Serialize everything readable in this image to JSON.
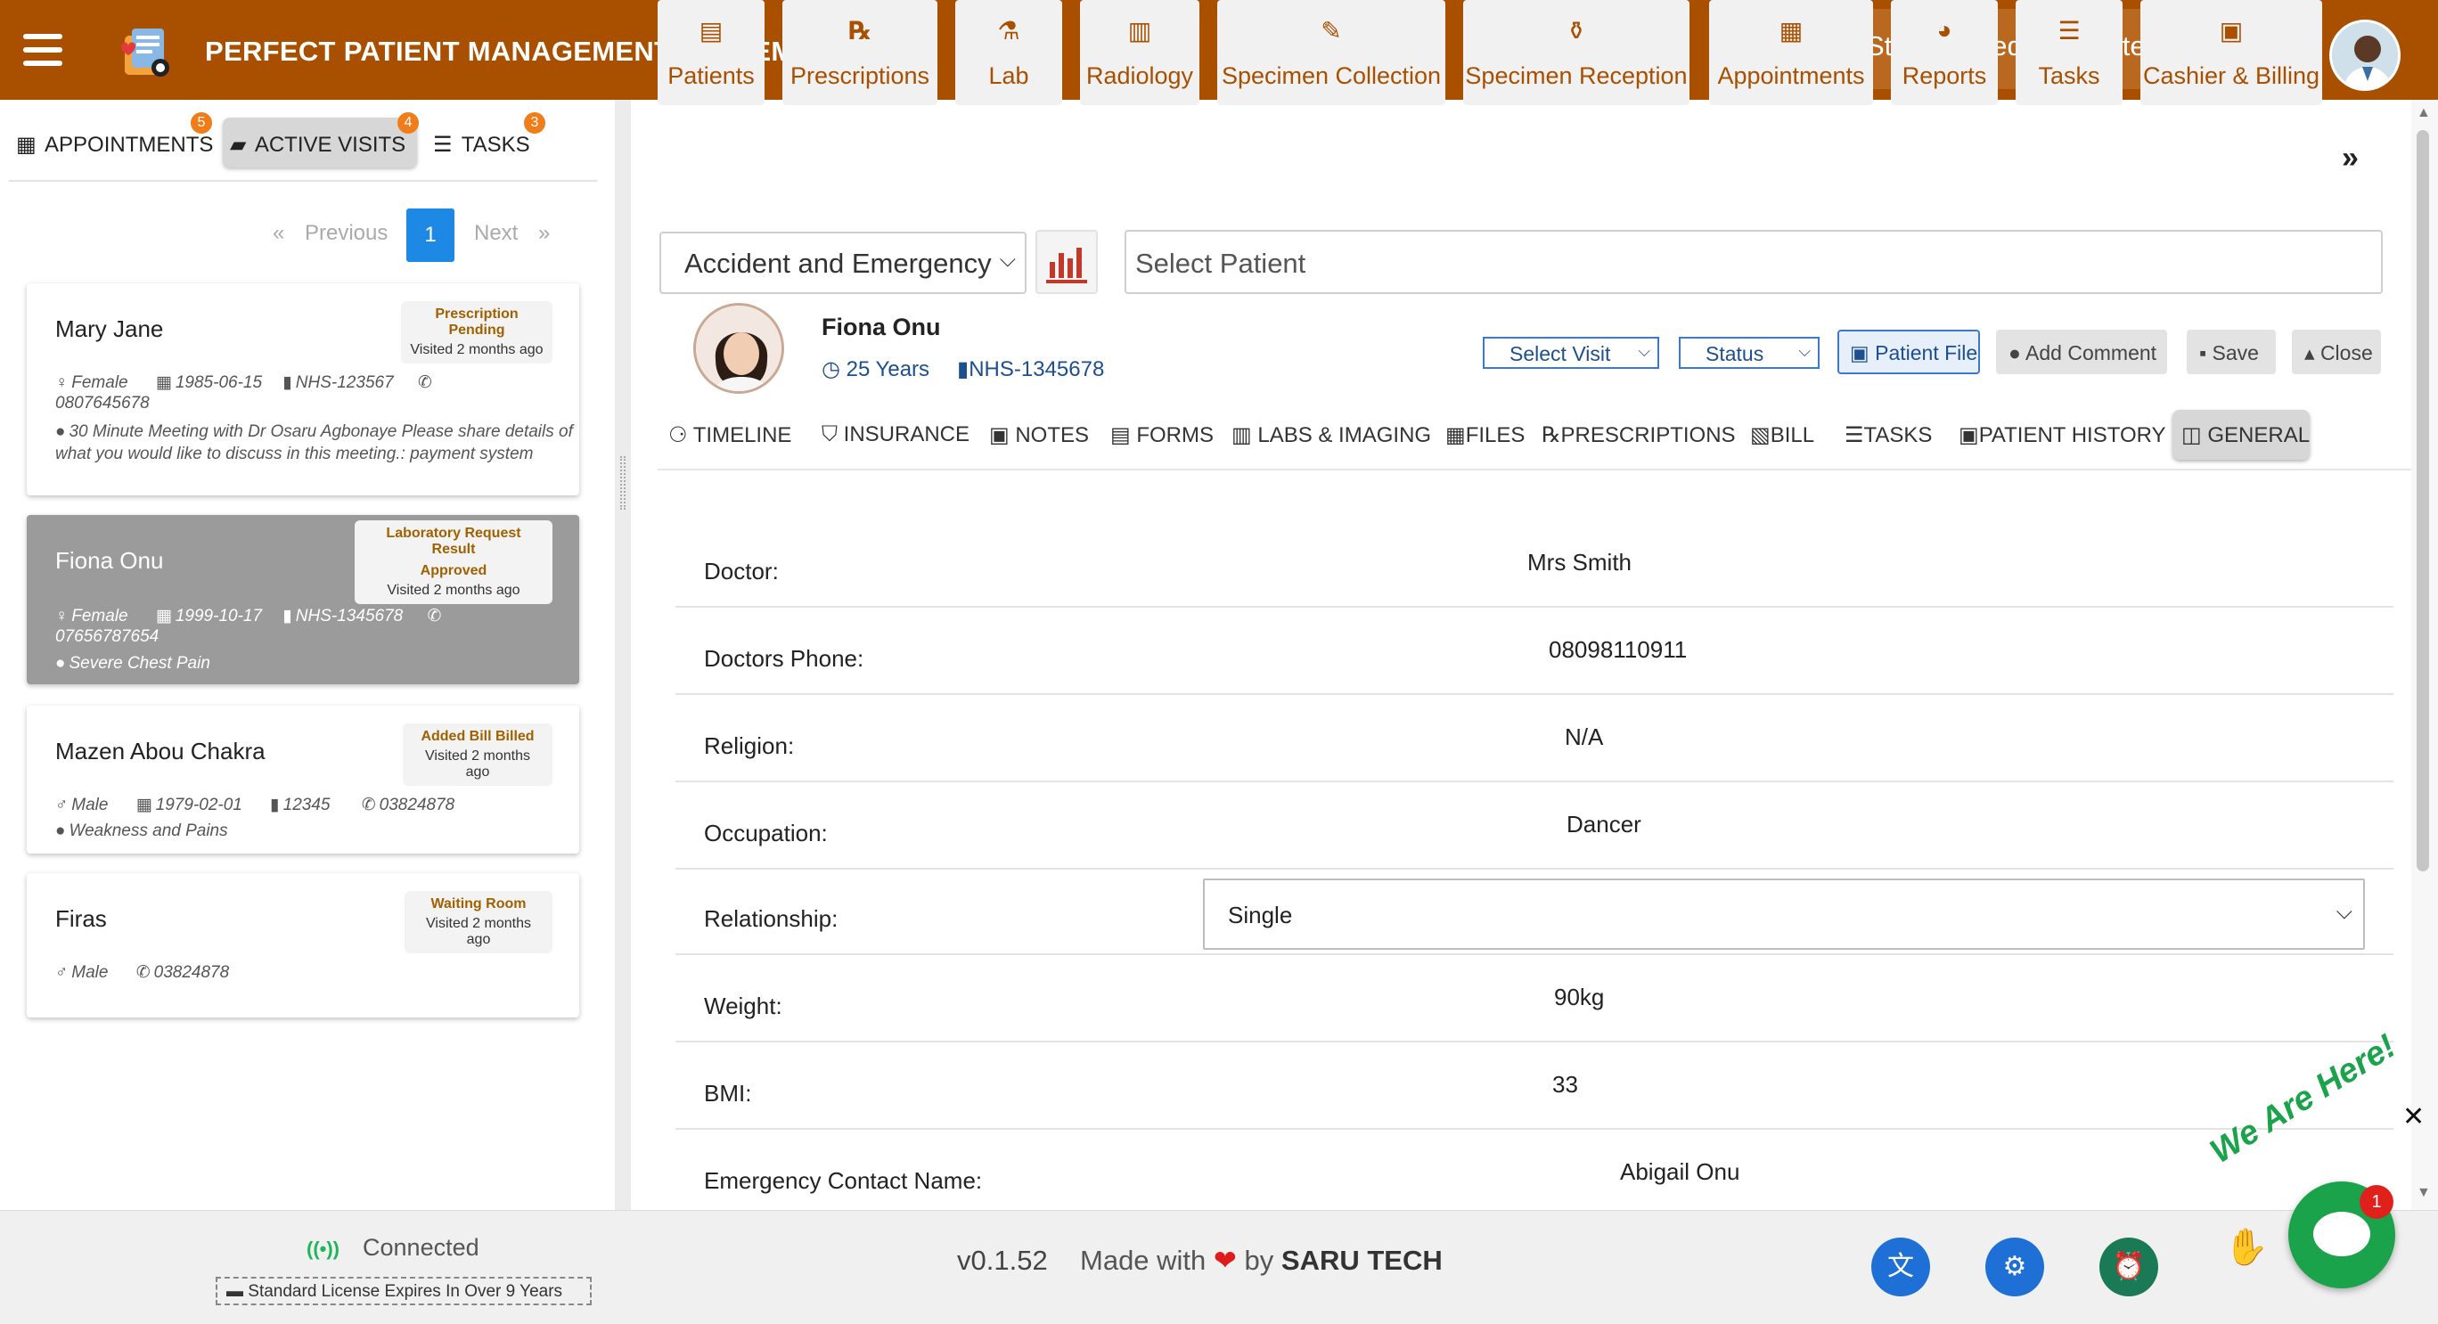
{
  "header": {
    "title": "PERFECT PATIENT MANAGEMENT SYSTEM",
    "facility": "St Mary Medical Center"
  },
  "left": {
    "tabs": [
      {
        "label": "APPOINTMENTS",
        "badge": "5"
      },
      {
        "label": "ACTIVE VISITS",
        "badge": "4"
      },
      {
        "label": "TASKS",
        "badge": "3"
      }
    ],
    "pager": {
      "previous": "Previous",
      "next": "Next",
      "current": "1",
      "prev_glyph": "«",
      "next_glyph": "»"
    },
    "visits": [
      {
        "name": "Mary Jane",
        "status": "Prescription Pending",
        "visited": "Visited 2 months ago",
        "gender": "Female",
        "dob": "1985-06-15",
        "nhs": "NHS-123567",
        "phone": "0807645678",
        "reason": "30 Minute Meeting with Dr Osaru Agbonaye Please share details of what you would like to discuss in this meeting.: payment system"
      },
      {
        "name": "Fiona Onu",
        "status": "Laboratory Request Result",
        "status2": "Approved",
        "visited": "Visited 2 months ago",
        "gender": "Female",
        "dob": "1999-10-17",
        "nhs": "NHS-1345678",
        "phone": "07656787654",
        "reason": "Severe Chest Pain"
      },
      {
        "name": "Mazen Abou Chakra",
        "status": "Added Bill Billed",
        "visited": "Visited 2 months ago",
        "gender": "Male",
        "dob": "1979-02-01",
        "nhs": "12345",
        "phone": "03824878",
        "reason": "Weakness and Pains"
      },
      {
        "name": "Firas",
        "status": "Waiting Room",
        "visited": "Visited 2 months ago",
        "gender": "Male",
        "phone": "03824878"
      }
    ]
  },
  "modules": [
    {
      "label": "Patients",
      "icon": "id-card-icon",
      "glyph": "▤"
    },
    {
      "label": "Prescriptions",
      "icon": "prescription-icon",
      "glyph": "℞"
    },
    {
      "label": "Lab",
      "icon": "flask-icon",
      "glyph": "⚗"
    },
    {
      "label": "Radiology",
      "icon": "radiology-icon",
      "glyph": "▥"
    },
    {
      "label": "Specimen Collection",
      "icon": "syringe-icon",
      "glyph": "✎"
    },
    {
      "label": "Specimen Reception",
      "icon": "vials-icon",
      "glyph": "⚱"
    },
    {
      "label": "Appointments",
      "icon": "calendar-icon",
      "glyph": "▦"
    },
    {
      "label": "Reports",
      "icon": "pie-chart-icon",
      "glyph": "◕"
    },
    {
      "label": "Tasks",
      "icon": "tasks-icon",
      "glyph": "☰"
    },
    {
      "label": "Cashier & Billing",
      "icon": "cash-register-icon",
      "glyph": "▣"
    }
  ],
  "more_glyph": "»",
  "department": "Accident and Emergency",
  "patient_search": {
    "placeholder": "Select  Patient"
  },
  "patient": {
    "name": "Fiona Onu",
    "age": "25 Years",
    "nhs": "NHS-1345678",
    "select_visit": "Select Visit",
    "status": "Status",
    "buttons": {
      "patient_file": "Patient File",
      "add_comment": "Add Comment",
      "save": "Save",
      "close": "Close"
    }
  },
  "patient_tabs": [
    "TIMELINE",
    "INSURANCE",
    "NOTES",
    "FORMS",
    "LABS & IMAGING",
    "FILES",
    "PRESCRIPTIONS",
    "BILL",
    "TASKS",
    "PATIENT HISTORY",
    "GENERAL"
  ],
  "general": [
    {
      "label": "Doctor:",
      "value": "Mrs Smith"
    },
    {
      "label": "Doctors Phone:",
      "value": "08098110911"
    },
    {
      "label": "Religion:",
      "value": "N/A"
    },
    {
      "label": "Occupation:",
      "value": "Dancer"
    },
    {
      "label": "Relationship:",
      "value": "Single"
    },
    {
      "label": "Weight:",
      "value": "90kg"
    },
    {
      "label": "BMI:",
      "value": "33"
    },
    {
      "label": "Emergency Contact Name:",
      "value": "Abigail Onu"
    }
  ],
  "footer": {
    "connected": "Connected",
    "license": "Standard License Expires In Over 9 Years",
    "version": "v0.1.52",
    "made_with": "Made with",
    "by": "by",
    "company": "SARU TECH",
    "chat_badge": "1",
    "chat_banner": "We Are Here!"
  },
  "colors": {
    "brand": "#a84f00",
    "accent_blue": "#1e88e5",
    "chat_green": "#1aa34a",
    "badge_orange": "#f07d1a"
  }
}
